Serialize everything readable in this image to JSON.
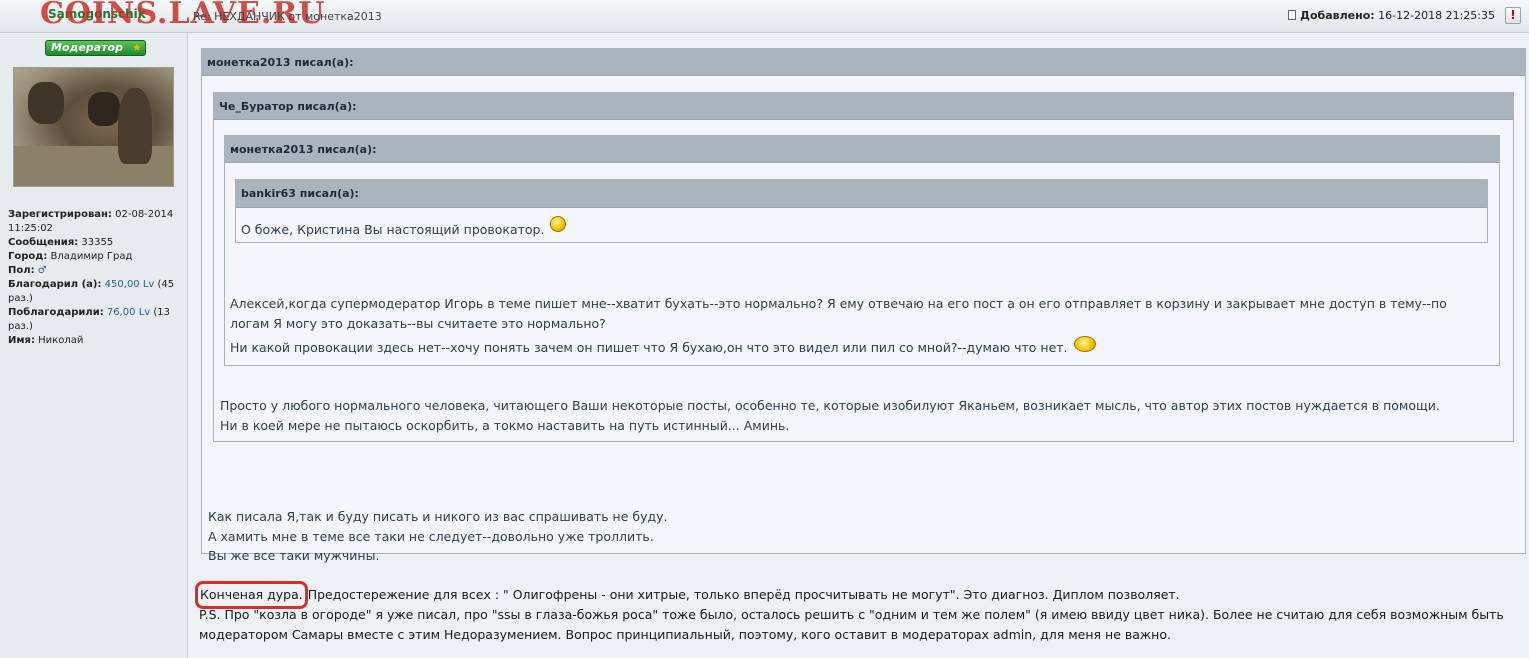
{
  "header": {
    "watermark": "COINS.LAVE.RU",
    "author": "Samogonschik",
    "subject": "Re: НЕХДАНЧИК от монетка2013",
    "date_label": "Добавлено:",
    "date_value": "16-12-2018 21:25:35",
    "report_label": "!"
  },
  "sidebar": {
    "badge": "Модератор",
    "stats": {
      "registered_label": "Зарегистрирован:",
      "registered_value": "02-08-2014 11:25:02",
      "messages_label": "Сообщения:",
      "messages_value": "33355",
      "city_label": "Город:",
      "city_value": "Владимир Град",
      "gender_label": "Пол:",
      "gender_value": "♂",
      "thanked_label": "Благодарил (а):",
      "thanked_value": "450,00 Lv",
      "thanked_times": "(45 раз.)",
      "received_label": "Поблагодарили:",
      "received_value": "76,00 Lv",
      "received_times": "(13 раз.)",
      "name_label": "Имя:",
      "name_value": "Николай"
    }
  },
  "quotes": {
    "q1_author": "монетка2013 писал(а):",
    "q2_author": "Че_Буратор писал(а):",
    "q3_author": "монетка2013 писал(а):",
    "q4_author": "bankir63 писал(а):",
    "q4_text": "О боже, Кристина Вы настоящий провокатор.",
    "q3_text_1": "Алексей,когда супермодератор Игорь в теме пишет мне--хватит бухать--это нормально? Я ему отвечаю на его пост а он его отправляет в корзину и закрывает мне доступ в тему--по логам Я могу это доказать--вы считаете это нормально?",
    "q3_text_2": "Ни какой провокации здесь нет--хочу понять зачем он пишет что Я бухаю,он что это видел или пил со мной?--думаю что нет.",
    "q2_text_1": "Просто у любого нормального человека, читающего Ваши некоторые посты, особенно те, которые изобилуют Яканьем, возникает мысль, что автор этих постов нуждается в помощи.",
    "q2_text_2": "Ни в коей мере не пытаюсь оскорбить, а токмо наставить на путь истинный... Аминь.",
    "q1_text_1": "Как писала Я,так и буду писать и никого из вас спрашивать не буду.",
    "q1_text_2": "А хамить мне в теме все таки не следует--довольно уже троллить.",
    "q1_text_3": "Вы же все таки мужчины."
  },
  "post": {
    "highlight": "Конченая дура.",
    "line1_rest": " Предостережение для всех : \" Олигофрены - они хитрые, только вперёд просчитывать не могут\". Это диагноз. Диплом позволяет.",
    "line2": "P.S. Про \"козла в огороде\" я уже писал, про \"ssы в глаза-божья роса\" тоже было, осталось решить с \"одним и тем же полем\" (я имею ввиду цвет ника). Более не считаю для себя возможным быть модератором Самары вместе с этим Недоразумением. Вопрос принципиальный, поэтому, кого оставит в модераторах admin, для меня не важно."
  }
}
